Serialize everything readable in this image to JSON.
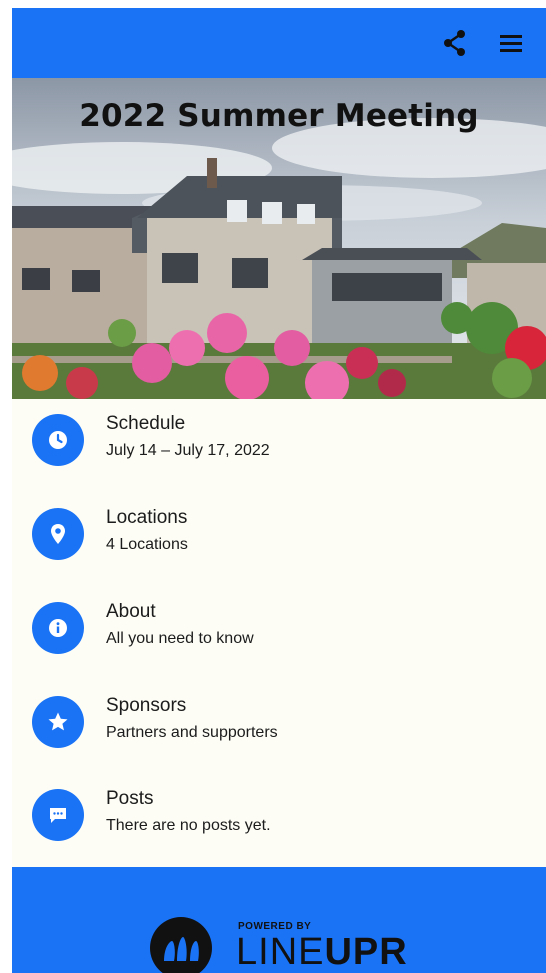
{
  "hero": {
    "title": "2022 Summer Meeting"
  },
  "menu": [
    {
      "icon": "clock-icon",
      "title": "Schedule",
      "subtitle": "July 14 – July 17, 2022"
    },
    {
      "icon": "location-pin-icon",
      "title": "Locations",
      "subtitle": "4 Locations"
    },
    {
      "icon": "info-icon",
      "title": "About",
      "subtitle": "All you need to know"
    },
    {
      "icon": "star-icon",
      "title": "Sponsors",
      "subtitle": "Partners and supporters"
    },
    {
      "icon": "chat-bubble-icon",
      "title": "Posts",
      "subtitle": "There are no posts yet."
    }
  ],
  "footer": {
    "powered_by": "POWERED BY",
    "brand_light": "LINE",
    "brand_bold": "UPR"
  },
  "colors": {
    "accent": "#1a73f5",
    "background": "#fdfdf6"
  }
}
